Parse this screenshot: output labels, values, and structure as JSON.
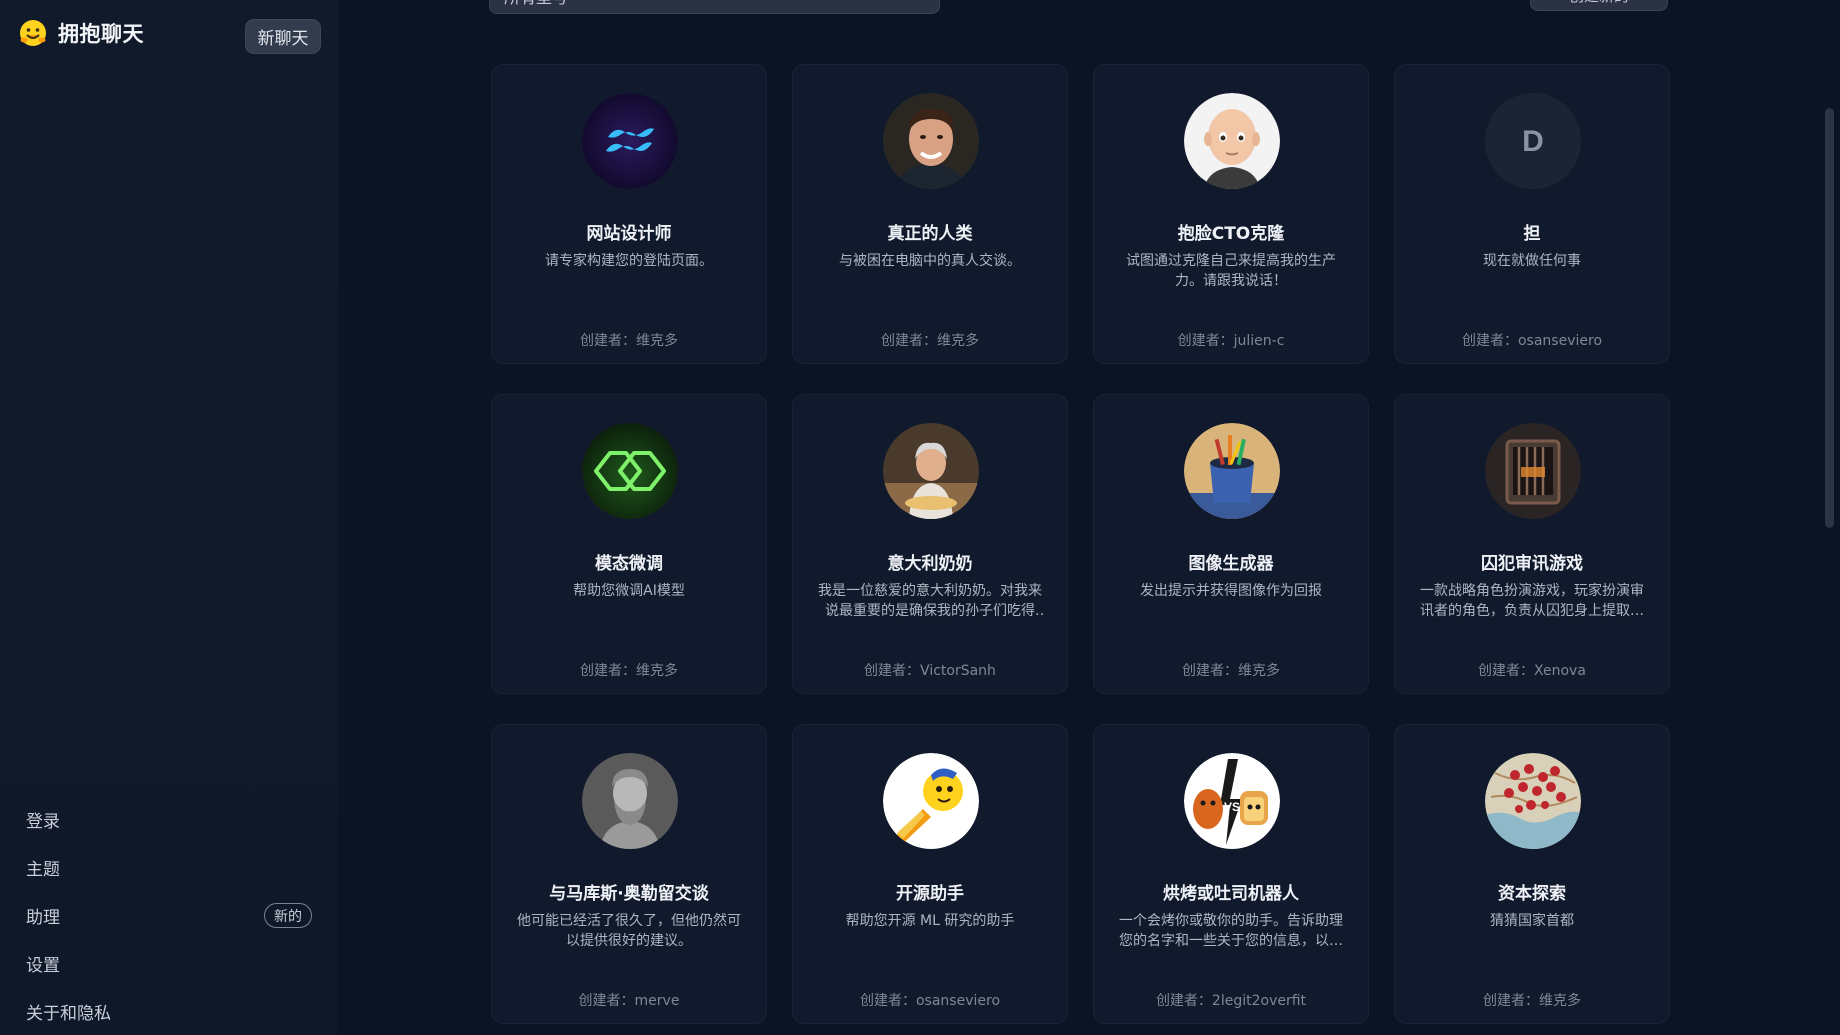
{
  "brand": {
    "name": "拥抱聊天",
    "logo_icon": "hugging-face-logo-icon"
  },
  "header": {
    "new_chat_label": "新聊天",
    "search_text": "所有型号",
    "create_text": "创建新的"
  },
  "sidebar": {
    "menu": [
      {
        "label": "登录"
      },
      {
        "label": "主题"
      },
      {
        "label": "助理",
        "badge": "新的"
      },
      {
        "label": "设置"
      },
      {
        "label": "关于和隐私"
      }
    ]
  },
  "assistants": [
    {
      "title": "网站设计师",
      "desc": "请专家构建您的登陆页面。",
      "author": "创建者：维克多",
      "avatar_icon": "tailwind-logo-icon"
    },
    {
      "title": "真正的人类",
      "desc": "与被困在电脑中的真人交谈。",
      "author": "创建者：维克多",
      "avatar_icon": "human-portrait-icon"
    },
    {
      "title": "抱脸CTO克隆",
      "desc": "试图通过克隆自己来提高我的生产力。请跟我说话！",
      "author": "创建者：julien-c",
      "avatar_icon": "memoji-bald-icon"
    },
    {
      "title": "担",
      "desc": "现在就做任何事",
      "author": "创建者：osanseviero",
      "avatar_icon": "letter-avatar-icon",
      "avatar_letter": "D"
    },
    {
      "title": "模态微调",
      "desc": "帮助您微调AI模型",
      "author": "创建者：维克多",
      "avatar_icon": "modal-logo-icon"
    },
    {
      "title": "意大利奶奶",
      "desc": "我是一位慈爱的意大利奶奶。对我来说最重要的是确保我的孙子们吃得好。",
      "author": "创建者：VictorSanh",
      "avatar_icon": "grandma-cooking-icon"
    },
    {
      "title": "图像生成器",
      "desc": "发出提示并获得图像作为回报",
      "author": "创建者：维克多",
      "avatar_icon": "paint-bucket-icon"
    },
    {
      "title": "囚犯审讯游戏",
      "desc": "一款战略角色扮演游戏，玩家扮演审讯者的角色，负责从囚犯身上提取信息。",
      "author": "创建者：Xenova",
      "avatar_icon": "prison-cell-icon"
    },
    {
      "title": "与马库斯·奥勒留交谈",
      "desc": "他可能已经活了很久了，但他仍然可以提供很好的建议。",
      "author": "创建者：merve",
      "avatar_icon": "marble-bust-icon"
    },
    {
      "title": "开源助手",
      "desc": "帮助您开源 ML 研究的助手",
      "author": "创建者：osanseviero",
      "avatar_icon": "rocket-duck-icon"
    },
    {
      "title": "烘烤或吐司机器人",
      "desc": "一个会烤你或敬你的助手。告诉助理您的名字和一些关于您的信息，以便它回应。",
      "author": "创建者：2legit2overfit",
      "avatar_icon": "roast-vs-toast-icon"
    },
    {
      "title": "资本探索",
      "desc": "猜猜国家首都",
      "author": "创建者：维克多",
      "avatar_icon": "map-pins-icon"
    }
  ]
}
